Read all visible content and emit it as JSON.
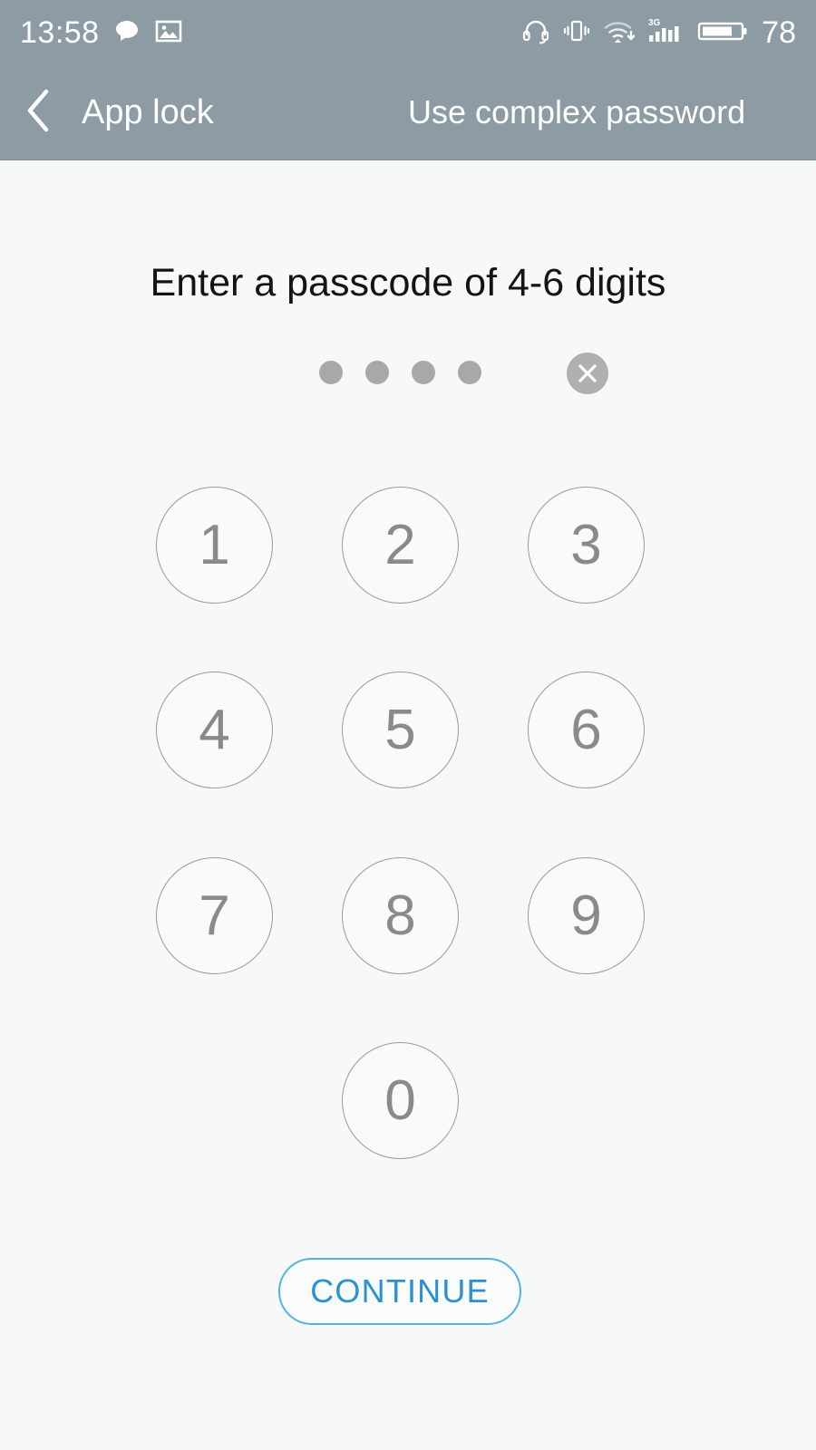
{
  "status_bar": {
    "time": "13:58",
    "battery_level": "78",
    "left_icons": [
      "message-bubble-icon",
      "photo-icon"
    ],
    "right_icons": [
      "headset-icon",
      "vibrate-icon",
      "wifi-download-icon",
      "3g-signal-icon",
      "battery-icon"
    ],
    "network_label": "3G",
    "background_color": "#8c9ba4",
    "text_color": "#ffffff"
  },
  "app_bar": {
    "back_icon": "chevron-left-icon",
    "title": "App lock",
    "action_label": "Use complex password"
  },
  "main": {
    "prompt": "Enter a passcode of 4-6 digits",
    "passcode": {
      "entered_count": 4,
      "dot_color": "#a8a8a8",
      "clear_icon": "close-x-icon",
      "clear_button_color": "#b0b0b0"
    },
    "keypad": {
      "keys": [
        "1",
        "2",
        "3",
        "4",
        "5",
        "6",
        "7",
        "8",
        "9",
        "0"
      ],
      "border_color": "#9a9a9a",
      "digit_color": "#8a8a8a"
    },
    "continue_label": "CONTINUE",
    "accent_color": "#2a91d4",
    "background_color": "#f7f8f8"
  }
}
